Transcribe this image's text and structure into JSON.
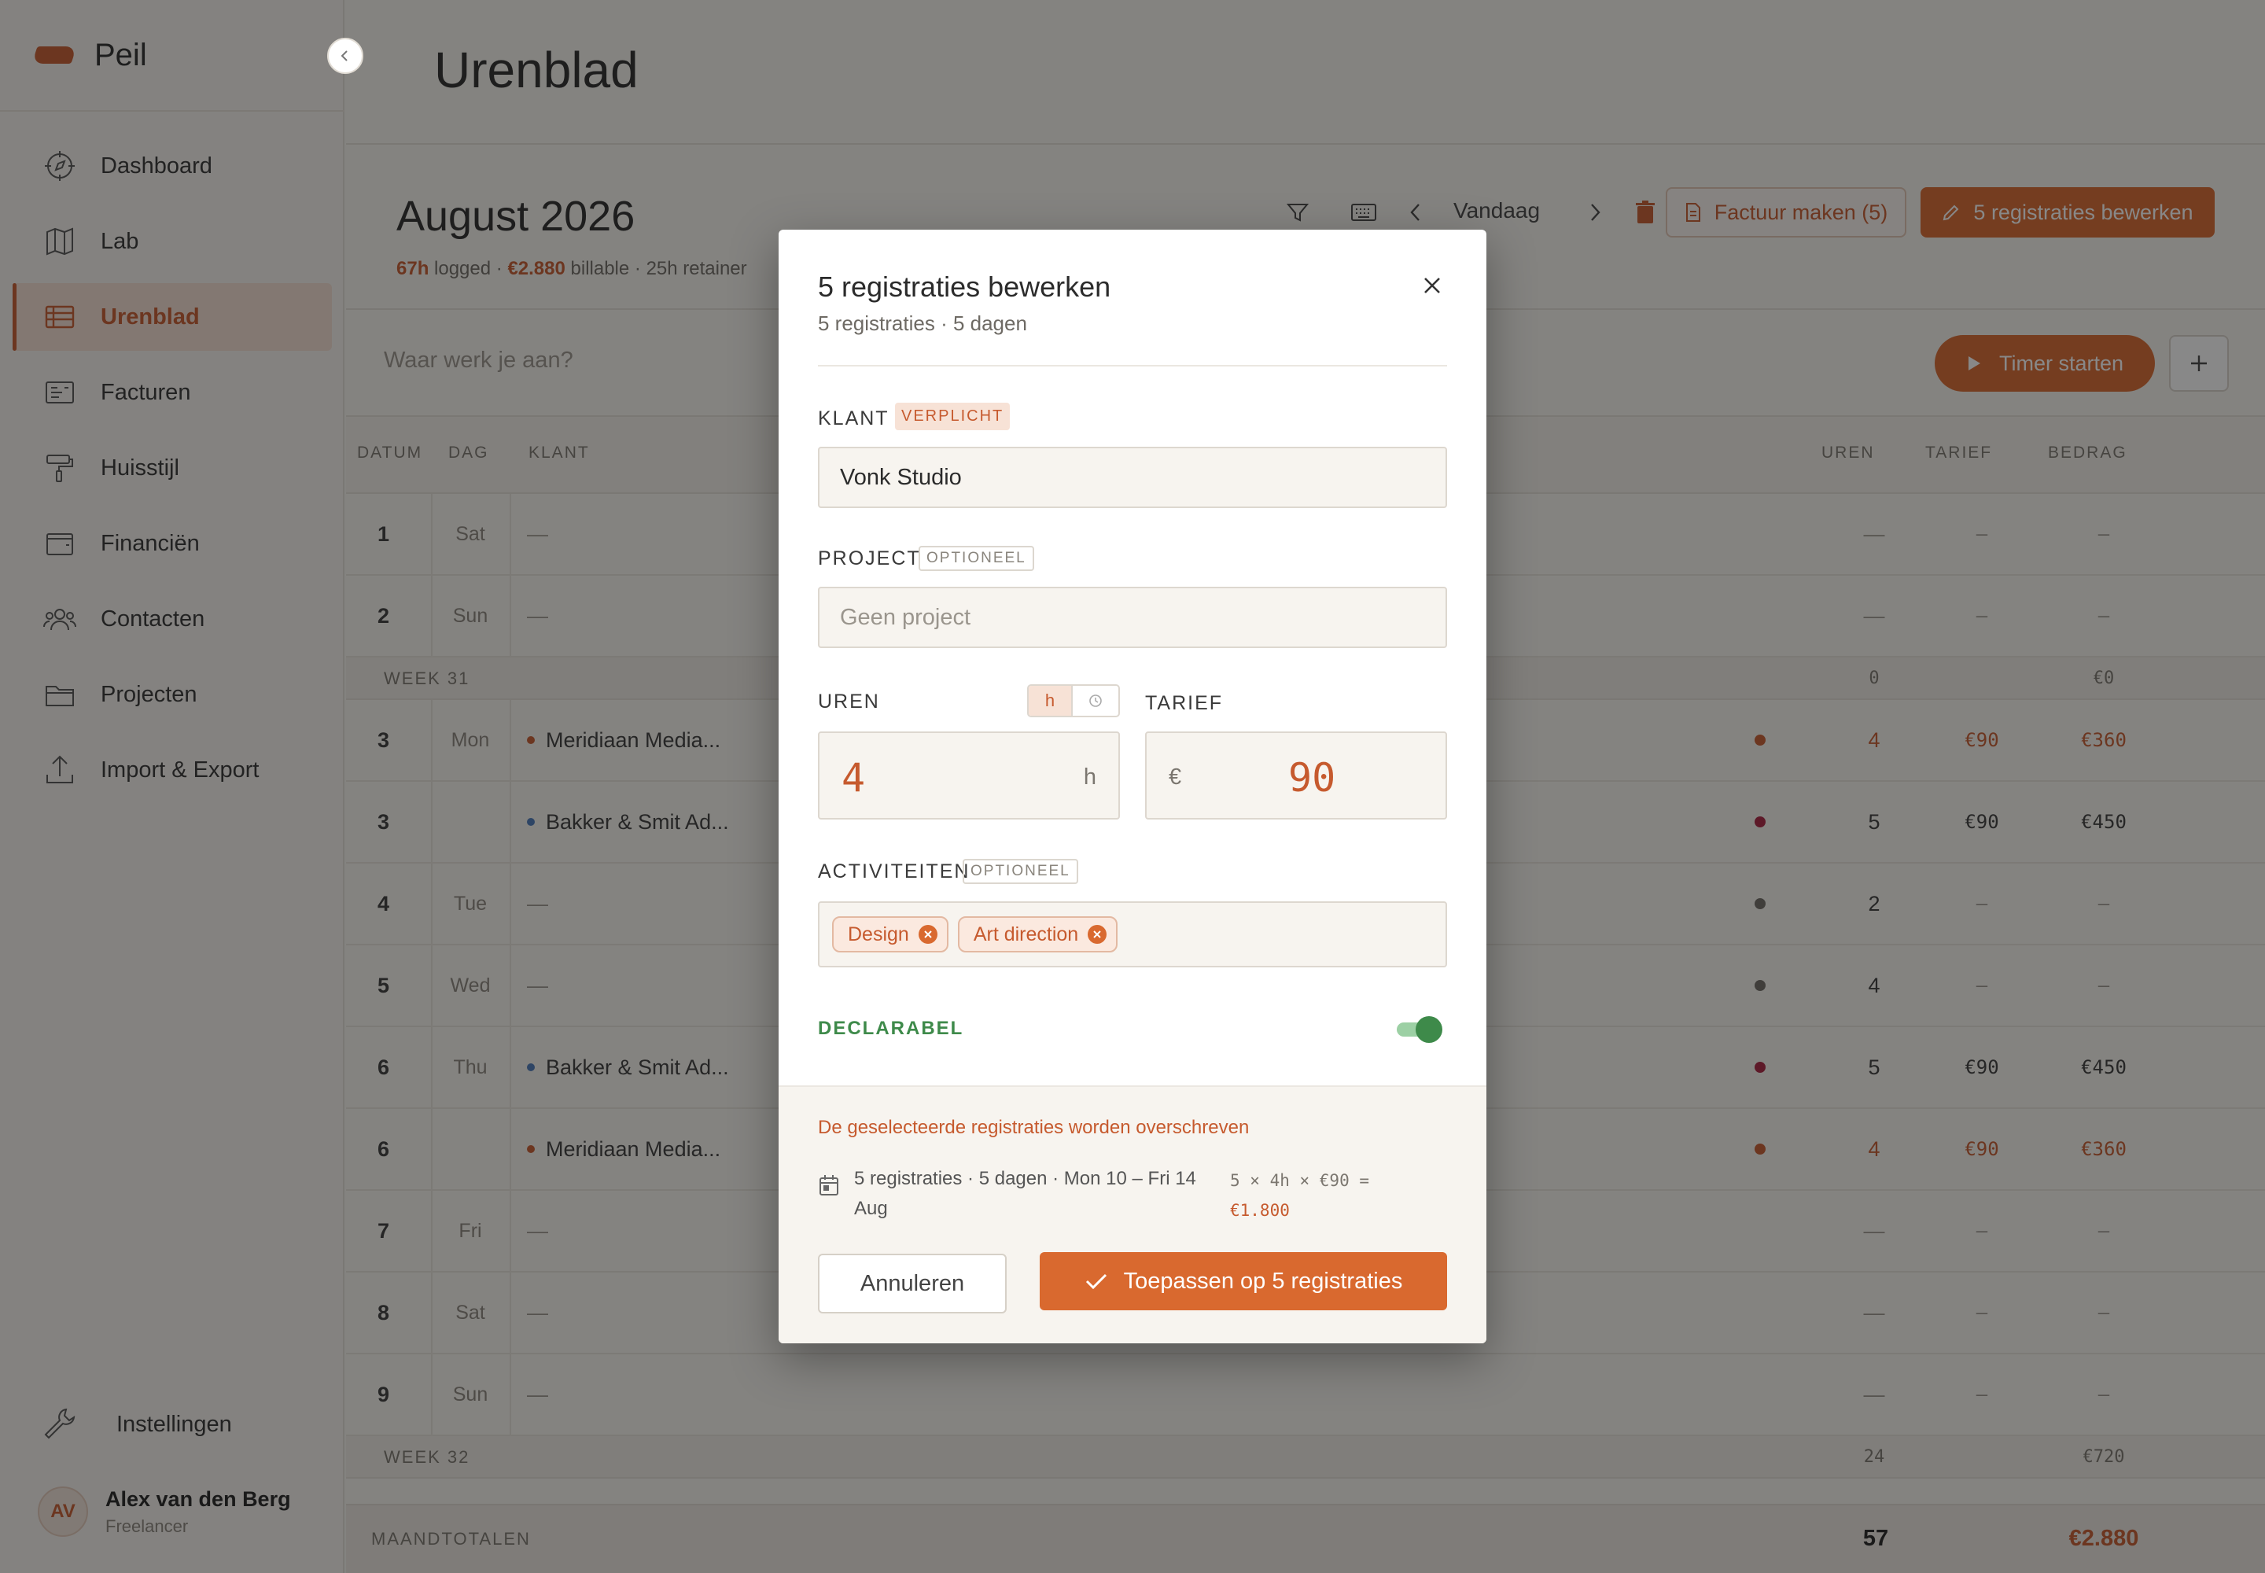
{
  "app": {
    "name": "Peil"
  },
  "sidebar": {
    "items": [
      {
        "label": "Dashboard",
        "icon": "compass-icon"
      },
      {
        "label": "Lab",
        "icon": "map-icon"
      },
      {
        "label": "Urenblad",
        "icon": "table-icon",
        "active": true
      },
      {
        "label": "Facturen",
        "icon": "invoice-icon"
      },
      {
        "label": "Huisstijl",
        "icon": "paint-roller-icon"
      },
      {
        "label": "Financiën",
        "icon": "wallet-icon"
      },
      {
        "label": "Contacten",
        "icon": "users-icon"
      },
      {
        "label": "Projecten",
        "icon": "folder-icon"
      },
      {
        "label": "Import & Export",
        "icon": "upload-icon"
      }
    ],
    "settings_label": "Instellingen",
    "user": {
      "initials": "AV",
      "name": "Alex van den Berg",
      "role": "Freelancer"
    }
  },
  "page": {
    "title": "Urenblad",
    "month": "August 2026",
    "summary": {
      "logged_value": "67h",
      "logged_label": "logged",
      "billable_value": "€2.880",
      "billable_label": "billable",
      "retainer": "25h retainer"
    }
  },
  "toolbar": {
    "today_label": "Vandaag",
    "invoice_button": "Factuur maken (5)",
    "edit_button": "5 registraties bewerken"
  },
  "quick_entry": {
    "placeholder": "Waar werk je aan?",
    "timer_button": "Timer starten"
  },
  "table": {
    "headers": {
      "date": "DATUM",
      "day": "DAG",
      "client": "KLANT",
      "hours": "UREN",
      "rate": "TARIEF",
      "amount": "BEDRAG"
    },
    "rows": [
      {
        "type": "day",
        "date": "1",
        "day": "Sat",
        "client": "—",
        "hours": "—",
        "rate": "—",
        "amount": "—"
      },
      {
        "type": "day",
        "date": "2",
        "day": "Sun",
        "client": "—",
        "hours": "—",
        "rate": "—",
        "amount": "—"
      },
      {
        "type": "week",
        "label": "WEEK 31",
        "hours": "0",
        "amount": "€0"
      },
      {
        "type": "day",
        "date": "3",
        "day": "Mon",
        "client": "Meridiaan Media...",
        "client_color": "#c65a2e",
        "status_color": "#c65a2e",
        "hours": "4",
        "rate": "€90",
        "amount": "€360",
        "highlight": true
      },
      {
        "type": "day",
        "date": "3",
        "day": "",
        "client": "Bakker & Smit Ad...",
        "client_color": "#4a78b8",
        "status_color": "#a8213e",
        "hours": "5",
        "rate": "€90",
        "amount": "€450"
      },
      {
        "type": "day",
        "date": "4",
        "day": "Tue",
        "client": "—",
        "status_color": "#6e6a64",
        "hours": "2",
        "rate": "—",
        "amount": "—"
      },
      {
        "type": "day",
        "date": "5",
        "day": "Wed",
        "client": "—",
        "status_color": "#6e6a64",
        "hours": "4",
        "rate": "—",
        "amount": "—"
      },
      {
        "type": "day",
        "date": "6",
        "day": "Thu",
        "client": "Bakker & Smit Ad...",
        "client_color": "#4a78b8",
        "status_color": "#a8213e",
        "hours": "5",
        "rate": "€90",
        "amount": "€450"
      },
      {
        "type": "day",
        "date": "6",
        "day": "",
        "client": "Meridiaan Media...",
        "client_color": "#c65a2e",
        "status_color": "#c65a2e",
        "hours": "4",
        "rate": "€90",
        "amount": "€360",
        "highlight": true
      },
      {
        "type": "day",
        "date": "7",
        "day": "Fri",
        "client": "—",
        "hours": "—",
        "rate": "—",
        "amount": "—"
      },
      {
        "type": "day",
        "date": "8",
        "day": "Sat",
        "client": "—",
        "hours": "—",
        "rate": "—",
        "amount": "—"
      },
      {
        "type": "day",
        "date": "9",
        "day": "Sun",
        "client": "—",
        "hours": "—",
        "rate": "—",
        "amount": "—"
      },
      {
        "type": "week",
        "label": "WEEK 32",
        "hours": "24",
        "amount": "€720"
      }
    ],
    "footer": {
      "label": "MAANDTOTALEN",
      "hours": "57",
      "amount": "€2.880"
    }
  },
  "modal": {
    "title": "5 registraties bewerken",
    "subtitle": "5 registraties · 5 dagen",
    "client": {
      "label": "KLANT",
      "badge": "VERPLICHT",
      "value": "Vonk Studio"
    },
    "project": {
      "label": "PROJECT",
      "badge": "OPTIONEEL",
      "placeholder": "Geen project"
    },
    "hours": {
      "label": "UREN",
      "unit_toggle": "h",
      "value": "4",
      "unit": "h"
    },
    "rate": {
      "label": "TARIEF",
      "currency": "€",
      "value": "90"
    },
    "activities": {
      "label": "ACTIVITEITEN",
      "badge": "OPTIONEEL",
      "chips": [
        "Design",
        "Art direction"
      ]
    },
    "billable": {
      "label": "DECLARABEL",
      "on": true
    },
    "footer": {
      "warning": "De geselecteerde registraties worden overschreven",
      "detail": "5 registraties · 5 dagen · Mon 10 – Fri 14 Aug",
      "calc": "5 × 4h × €90 =",
      "calc_result": "€1.800",
      "cancel": "Annuleren",
      "apply": "Toepassen op 5 registraties"
    }
  },
  "colors": {
    "accent": "#d9692f",
    "accent_dark": "#c65a2e",
    "success": "#3e8a4a",
    "background": "#f7f4ef"
  }
}
